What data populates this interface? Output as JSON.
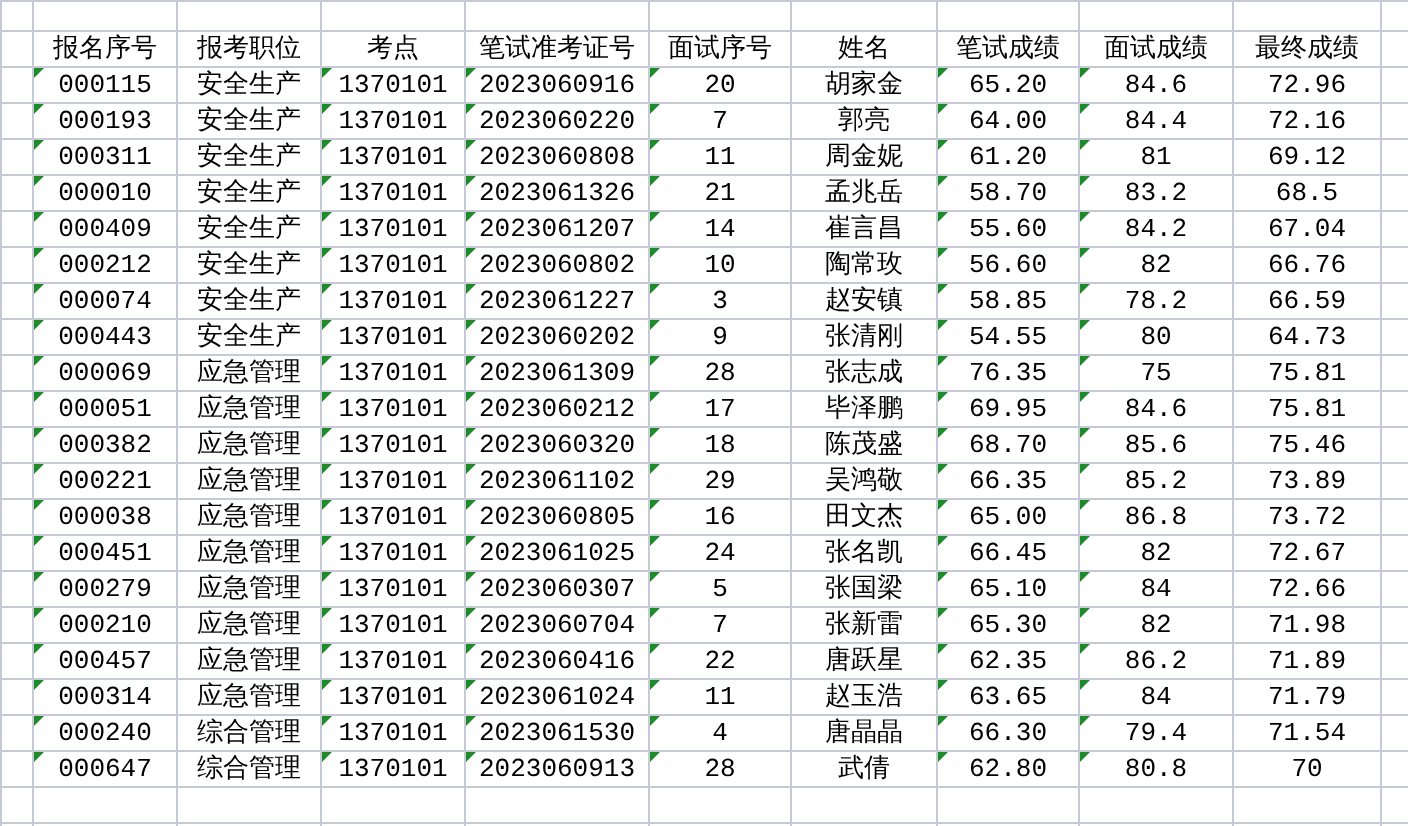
{
  "sheet": {
    "columns": [
      {
        "label": "报名序号",
        "flagged": true
      },
      {
        "label": "报考职位",
        "flagged": false
      },
      {
        "label": "考点",
        "flagged": true
      },
      {
        "label": "笔试准考证号",
        "flagged": true
      },
      {
        "label": "面试序号",
        "flagged": true
      },
      {
        "label": "姓名",
        "flagged": false
      },
      {
        "label": "笔试成绩",
        "flagged": true
      },
      {
        "label": "面试成绩",
        "flagged": true
      },
      {
        "label": "最终成绩",
        "flagged": false
      }
    ],
    "rows": [
      [
        "000115",
        "安全生产",
        "1370101",
        "2023060916",
        "20",
        "胡家金",
        "65.20",
        "84.6",
        "72.96"
      ],
      [
        "000193",
        "安全生产",
        "1370101",
        "2023060220",
        "7",
        "郭亮",
        "64.00",
        "84.4",
        "72.16"
      ],
      [
        "000311",
        "安全生产",
        "1370101",
        "2023060808",
        "11",
        "周金妮",
        "61.20",
        "81",
        "69.12"
      ],
      [
        "000010",
        "安全生产",
        "1370101",
        "2023061326",
        "21",
        "孟兆岳",
        "58.70",
        "83.2",
        "68.5"
      ],
      [
        "000409",
        "安全生产",
        "1370101",
        "2023061207",
        "14",
        "崔言昌",
        "55.60",
        "84.2",
        "67.04"
      ],
      [
        "000212",
        "安全生产",
        "1370101",
        "2023060802",
        "10",
        "陶常玫",
        "56.60",
        "82",
        "66.76"
      ],
      [
        "000074",
        "安全生产",
        "1370101",
        "2023061227",
        "3",
        "赵安镇",
        "58.85",
        "78.2",
        "66.59"
      ],
      [
        "000443",
        "安全生产",
        "1370101",
        "2023060202",
        "9",
        "张清刚",
        "54.55",
        "80",
        "64.73"
      ],
      [
        "000069",
        "应急管理",
        "1370101",
        "2023061309",
        "28",
        "张志成",
        "76.35",
        "75",
        "75.81"
      ],
      [
        "000051",
        "应急管理",
        "1370101",
        "2023060212",
        "17",
        "毕泽鹏",
        "69.95",
        "84.6",
        "75.81"
      ],
      [
        "000382",
        "应急管理",
        "1370101",
        "2023060320",
        "18",
        "陈茂盛",
        "68.70",
        "85.6",
        "75.46"
      ],
      [
        "000221",
        "应急管理",
        "1370101",
        "2023061102",
        "29",
        "吴鸿敬",
        "66.35",
        "85.2",
        "73.89"
      ],
      [
        "000038",
        "应急管理",
        "1370101",
        "2023060805",
        "16",
        "田文杰",
        "65.00",
        "86.8",
        "73.72"
      ],
      [
        "000451",
        "应急管理",
        "1370101",
        "2023061025",
        "24",
        "张名凯",
        "66.45",
        "82",
        "72.67"
      ],
      [
        "000279",
        "应急管理",
        "1370101",
        "2023060307",
        "5",
        "张国梁",
        "65.10",
        "84",
        "72.66"
      ],
      [
        "000210",
        "应急管理",
        "1370101",
        "2023060704",
        "7",
        "张新雷",
        "65.30",
        "82",
        "71.98"
      ],
      [
        "000457",
        "应急管理",
        "1370101",
        "2023060416",
        "22",
        "唐跃星",
        "62.35",
        "86.2",
        "71.89"
      ],
      [
        "000314",
        "应急管理",
        "1370101",
        "2023061024",
        "11",
        "赵玉浩",
        "63.65",
        "84",
        "71.79"
      ],
      [
        "000240",
        "综合管理",
        "1370101",
        "2023061530",
        "4",
        "唐晶晶",
        "66.30",
        "79.4",
        "71.54"
      ],
      [
        "000647",
        "综合管理",
        "1370101",
        "2023060913",
        "28",
        "武倩",
        "62.80",
        "80.8",
        "70"
      ]
    ]
  }
}
